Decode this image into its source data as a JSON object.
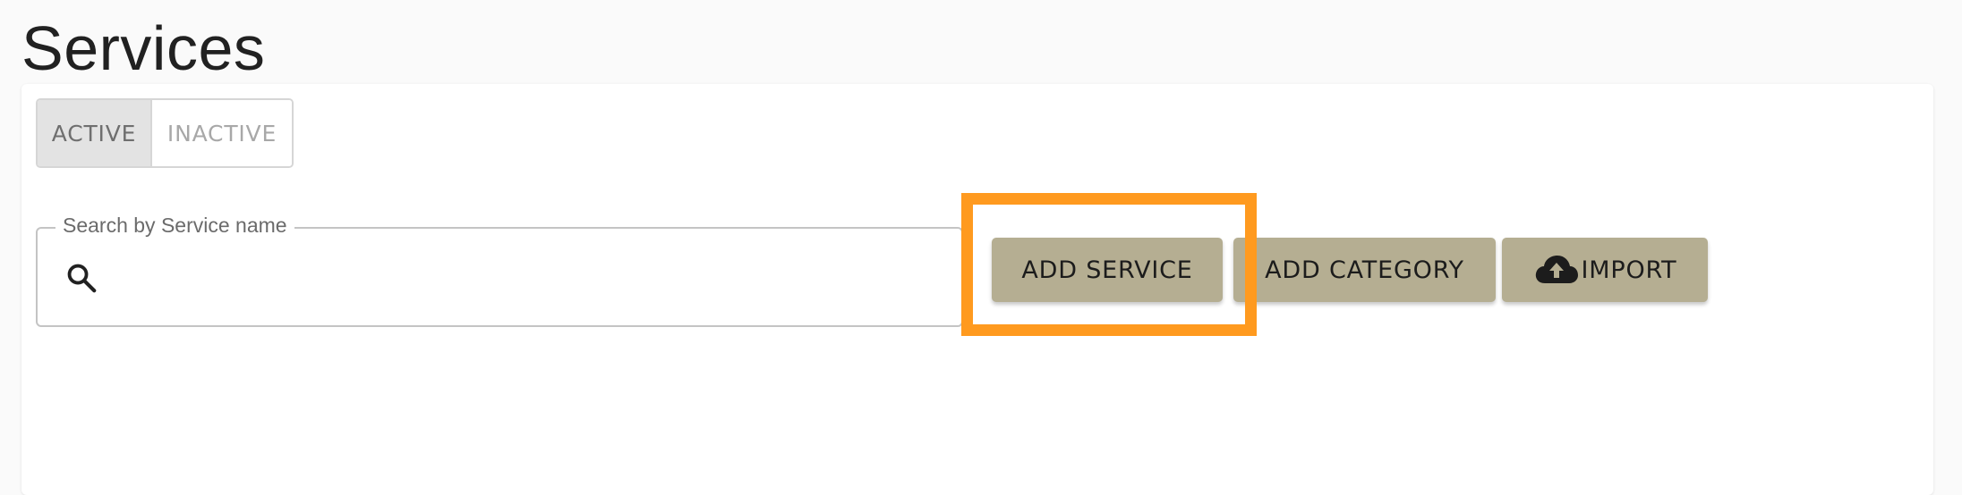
{
  "page": {
    "title": "Services"
  },
  "status_toggle": {
    "active_label": "ACTIVE",
    "inactive_label": "INACTIVE",
    "selected": "ACTIVE"
  },
  "search": {
    "label": "Search by Service name",
    "value": "",
    "icon": "search-icon"
  },
  "actions": {
    "add_service_label": "ADD SERVICE",
    "add_category_label": "ADD CATEGORY",
    "import_label": "IMPORT",
    "import_icon": "cloud-upload-icon",
    "button_color": "#b5ae92"
  },
  "annotation": {
    "highlight_color": "#ff9a1f"
  }
}
